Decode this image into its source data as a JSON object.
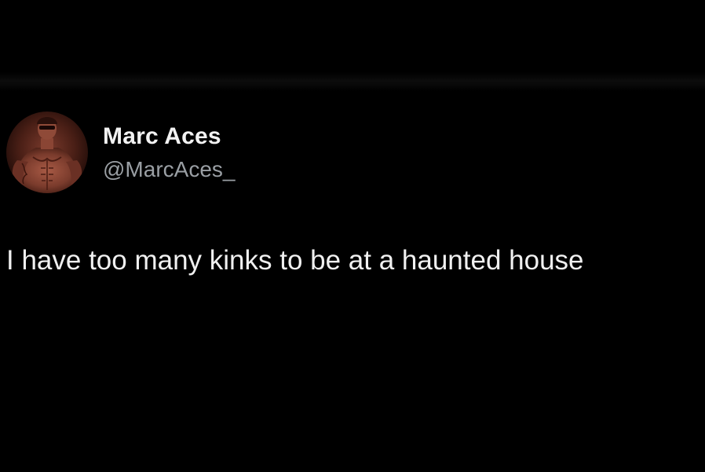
{
  "tweet": {
    "author": {
      "display_name": "Marc Aces",
      "handle": "@MarcAces_",
      "avatar_icon": "profile-photo"
    },
    "text": "I have too many kinks to be at a haunted house"
  },
  "theme": {
    "background": "#000000",
    "text_primary": "#f0f0f0",
    "text_secondary": "#9a9fa4"
  }
}
